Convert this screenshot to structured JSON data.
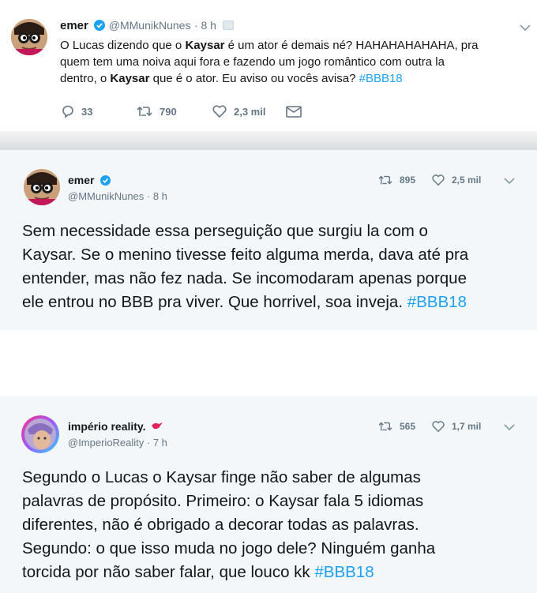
{
  "tweet1": {
    "name": "emer",
    "handle": "@MMunikNunes",
    "time": "· 8 h",
    "text_a": "O Lucas dizendo que o ",
    "bold1": "Kaysar",
    "text_b": " é um ator é demais né? HAHAHAHAHAHA, pra",
    "line2": "quem tem uma noiva aqui fora e fazendo um jogo romântico com outra la",
    "text_c": "dentro, o ",
    "bold2": "Kaysar",
    "text_d": " que é o ator. Eu aviso ou vocês avisa? ",
    "hashtag": "#BBB18",
    "replies": "33",
    "retweets": "790",
    "likes": "2,3 mil"
  },
  "tweet2": {
    "name": "emer",
    "handle": "@MMunikNunes · 8 h",
    "retweets": "895",
    "likes": "2,5 mil",
    "line1": "Sem necessidade essa perseguição que surgiu la com o",
    "line2": "Kaysar. Se o menino tivesse feito alguma merda, dava até pra",
    "line3": "entender, mas não fez nada. Se incomodaram apenas porque",
    "line4": "ele entrou no BBB pra viver. Que horrivel, soa inveja. ",
    "hashtag": "#BBB18"
  },
  "tweet3": {
    "name": "império reality.",
    "handle": "@ImperioReality · 7 h",
    "retweets": "565",
    "likes": "1,7 mil",
    "line1": "Segundo o Lucas o Kaysar finge não saber de algumas",
    "line2": "palavras de propósito. Primeiro: o Kaysar fala 5 idiomas",
    "line3": "diferentes, não é obrigado a decorar todas as palavras.",
    "line4": "Segundo: o que isso muda no jogo dele? Ninguém ganha",
    "line5": "torcida por não saber falar, que louco kk ",
    "hashtag": "#BBB18"
  },
  "colors": {
    "accent": "#1da1f2",
    "muted": "#657786",
    "text": "#14171a"
  },
  "icons": [
    "reply-icon",
    "retweet-icon",
    "like-icon",
    "message-icon",
    "verified-icon",
    "chevron-down-icon",
    "bird-emoji-icon"
  ]
}
